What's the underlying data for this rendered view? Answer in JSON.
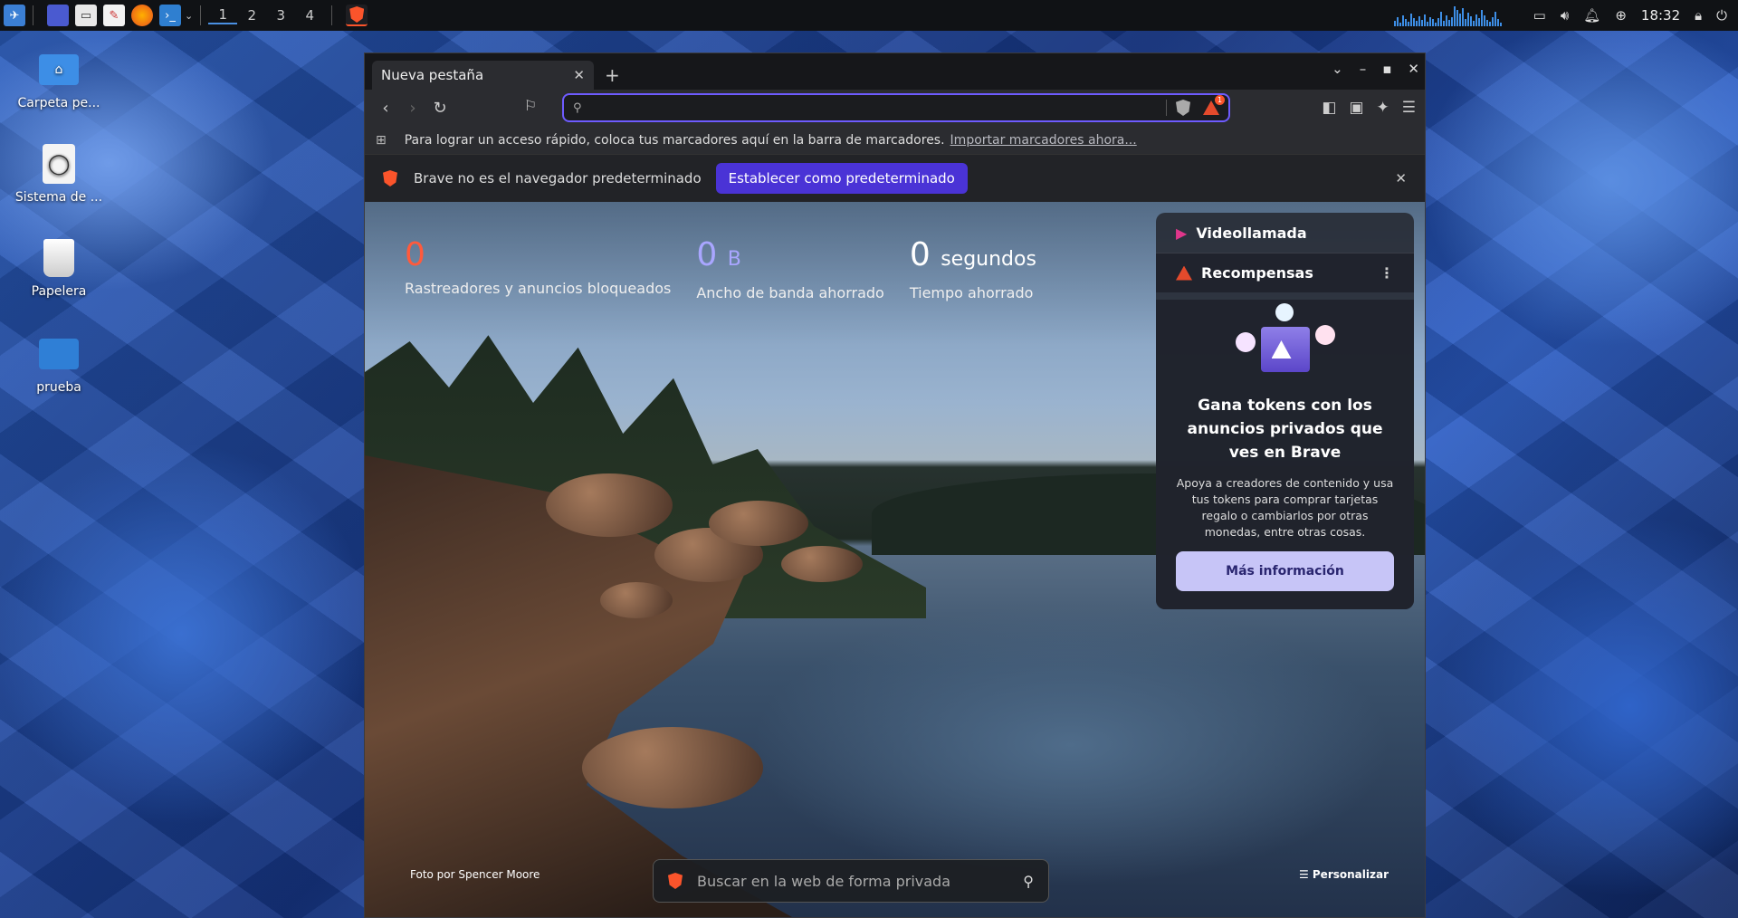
{
  "taskbar": {
    "workspaces": [
      "1",
      "2",
      "3",
      "4"
    ],
    "clock": "18:32"
  },
  "desktop": {
    "icons": [
      {
        "label": "Carpeta pe...",
        "icon": "home-folder-icon"
      },
      {
        "label": "Sistema de ...",
        "icon": "drive-icon"
      },
      {
        "label": "Papelera",
        "icon": "trash-icon"
      },
      {
        "label": "prueba",
        "icon": "folder-icon"
      }
    ]
  },
  "browser": {
    "tab_title": "Nueva pestaña",
    "url_value": "",
    "bookmarks_bar": {
      "text": "Para lograr un acceso rápido, coloca tus marcadores aquí en la barra de marcadores.",
      "link": "Importar marcadores ahora..."
    },
    "infobar": {
      "text": "Brave no es el navegador predeterminado",
      "button": "Establecer como predeterminado"
    },
    "stats": [
      {
        "value": "0",
        "unit": "",
        "label": "Rastreadores y anuncios bloqueados",
        "color": "#ff5a3c"
      },
      {
        "value": "0",
        "unit": "B",
        "label": "Ancho de banda ahorrado",
        "color": "#a9a6ff"
      },
      {
        "value": "0",
        "unit": "segundos",
        "label": "Tiempo ahorrado",
        "color": "#ffffff"
      }
    ],
    "widget": {
      "videocall": "Videollamada",
      "rewards": "Recompensas",
      "title": "Gana tokens con los anuncios privados que ves en Brave",
      "desc": "Apoya a creadores de contenido y usa tus tokens para comprar tarjetas regalo o cambiarlos por otras monedas, entre otras cosas.",
      "button": "Más información"
    },
    "photo_credit": "Foto por Spencer Moore",
    "customize": "Personalizar",
    "search_placeholder": "Buscar en la web de forma privada",
    "notification_count": "1"
  },
  "colors": {
    "accent": "#6e5bff",
    "brand": "#fb542b"
  }
}
